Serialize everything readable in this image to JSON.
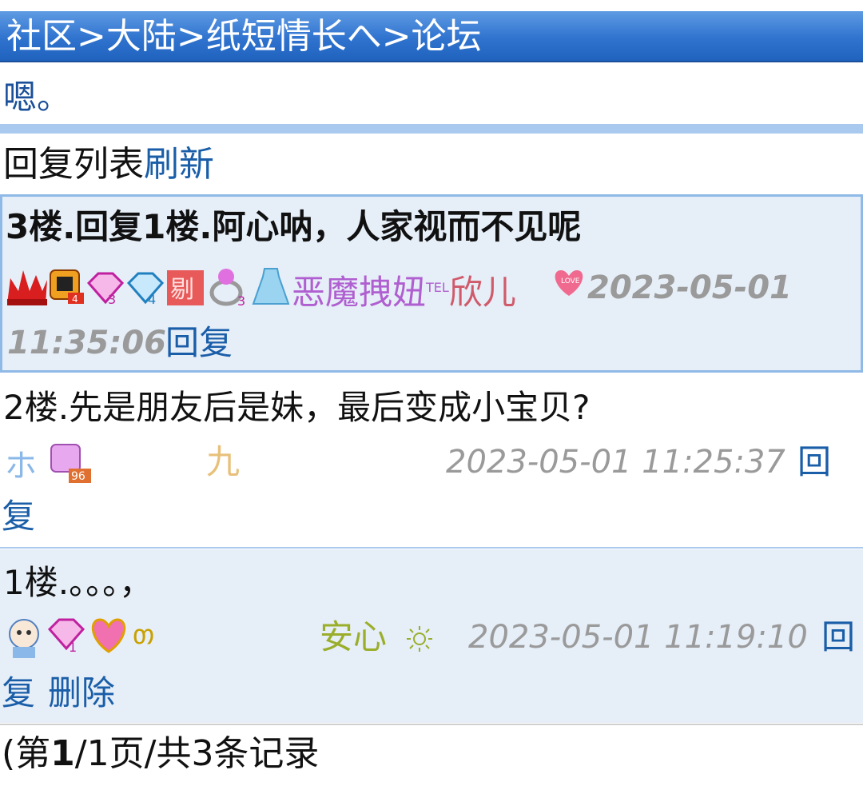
{
  "breadcrumb": "社区>大陆>纸短情长へ>论坛",
  "post_title": "嗯。",
  "reply_list": {
    "label": "回复列表",
    "refresh": "刷新"
  },
  "floors": [
    {
      "text": "3楼.回复1楼.阿心呐，人家视而不见呢",
      "user": {
        "name_part1": "恶魔拽妞",
        "superscript": "TEL",
        "name_part2": "欣儿"
      },
      "date": "2023-05-01",
      "time": "11:35:06",
      "reply": "回复",
      "badges": [
        "crown-icon",
        "level-badge-icon",
        "diamond-badge-3-icon",
        "diamond-badge-4-icon",
        "ban-badge-icon",
        "ring-badge-icon",
        "dress-icon",
        "love-heart-icon"
      ]
    },
    {
      "text": "2楼.先是朋友后是妹，最后变成小宝贝?",
      "user": {
        "name": "九"
      },
      "datetime": "2023-05-01 11:25:37",
      "reply_a": "回",
      "reply_b": "复",
      "badges": [
        "avatar-sketch-icon",
        "gift-badge-96-icon"
      ]
    },
    {
      "text": "1楼.。。。，",
      "user": {
        "name": "安心",
        "deco": "sun-doodle-icon"
      },
      "datetime": "2023-05-01 11:19:10",
      "reply_a": "回",
      "reply_b": "复",
      "delete": "删除",
      "badges": [
        "baby-avatar-icon",
        "diamond-badge-1-icon",
        "heart-badge-icon",
        "curl-deco-icon"
      ]
    }
  ],
  "pager": {
    "prefix": "(第",
    "page": "1",
    "suffix": "/1页/共3条记录"
  },
  "colors": {
    "header": "#2f73cf",
    "link": "#1a5ea8",
    "floor_bg": "#e6eef8",
    "time": "#9a9a9a",
    "name_f3": "#b05fd0",
    "name_f3_b": "#d05a6a",
    "name_f2": "#e8c07a",
    "name_f1": "#9aae2a"
  }
}
